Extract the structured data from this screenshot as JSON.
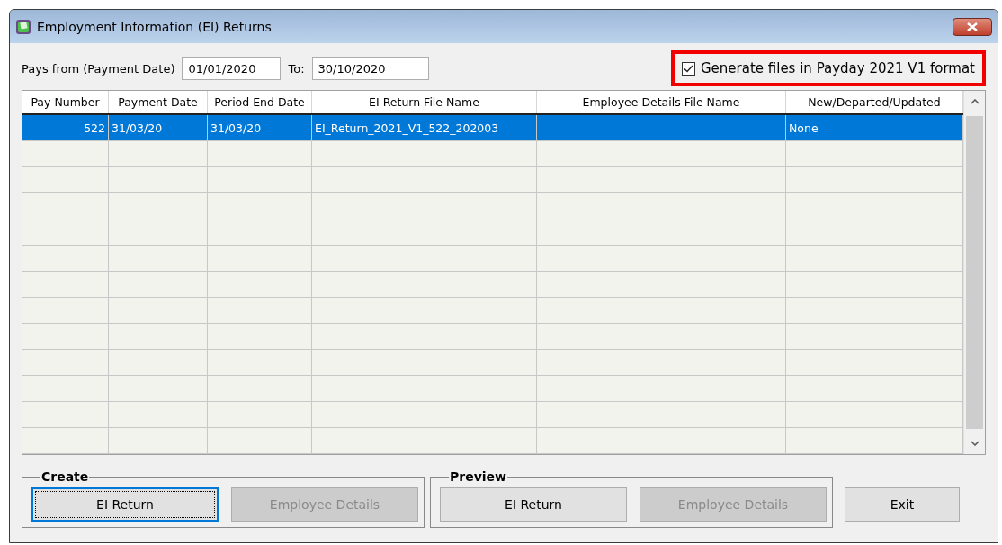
{
  "window": {
    "title": "Employment Information (EI) Returns"
  },
  "filter": {
    "from_label": "Pays from (Payment Date)",
    "from_value": "01/01/2020",
    "to_label": "To:",
    "to_value": "30/10/2020"
  },
  "generate_option": {
    "label": "Generate files in Payday 2021 V1 format",
    "checked": true
  },
  "table": {
    "columns": [
      "Pay Number",
      "Payment Date",
      "Period End Date",
      "EI Return File Name",
      "Employee Details File Name",
      "New/Departed/Updated"
    ],
    "rows": [
      {
        "cells": [
          "522",
          "31/03/20",
          "31/03/20",
          "EI_Return_2021_V1_522_202003",
          "",
          "None"
        ],
        "selected": true
      }
    ]
  },
  "groups": [
    {
      "title": "Create",
      "buttons": [
        {
          "label": "EI Return",
          "disabled": false,
          "focused": true
        },
        {
          "label": "Employee Details",
          "disabled": true,
          "focused": false
        }
      ]
    },
    {
      "title": "Preview",
      "buttons": [
        {
          "label": "EI Return",
          "disabled": false,
          "focused": false
        },
        {
          "label": "Employee Details",
          "disabled": true,
          "focused": false
        }
      ]
    }
  ],
  "exit_button": {
    "label": "Exit"
  }
}
